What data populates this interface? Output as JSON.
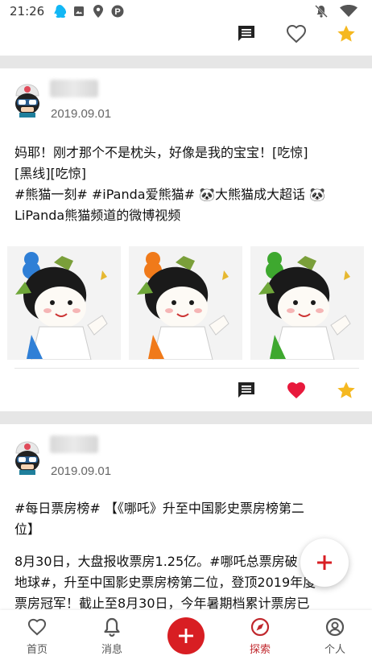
{
  "status_bar": {
    "time": "21:26",
    "left_icons": [
      "qq-icon",
      "image-icon",
      "location-icon",
      "p-icon"
    ],
    "right_icons": [
      "mute-icon",
      "wifi-icon"
    ]
  },
  "colors": {
    "accent": "#d81e23",
    "like": "#e8193c",
    "star": "#f5b820",
    "band": "#e6e6e6"
  },
  "posts": [
    {
      "date": "2019.09.01",
      "text_lines": [
        "妈耶！刚才那个不是枕头，好像是我的宝宝！[吃惊]",
        "[黑线][吃惊]",
        "#熊猫一刻# #iPanda爱熊猫# 🐼大熊猫成大超话 🐼",
        "LiPanda熊猫频道的微博视频"
      ],
      "liked": true,
      "starred": true
    },
    {
      "date": "2019.09.01",
      "text_lines": [
        "#每日票房榜# 【《哪吒》升至中国影史票房榜第二",
        "位】"
      ],
      "text_lines_2": [
        "8月30日，大盘报收票房1.25亿。#哪吒总票房破",
        "地球#，升至中国影史票房榜第二位，登顶2019年度",
        "票房冠军！截止至8月30日，今年暑期档累计票房已"
      ]
    }
  ],
  "bottom_nav": {
    "items": [
      {
        "label": "首页",
        "icon": "heart-icon"
      },
      {
        "label": "消息",
        "icon": "bell-icon"
      },
      {
        "label": "探索",
        "icon": "compass-icon",
        "active": true
      },
      {
        "label": "个人",
        "icon": "person-icon"
      }
    ]
  }
}
